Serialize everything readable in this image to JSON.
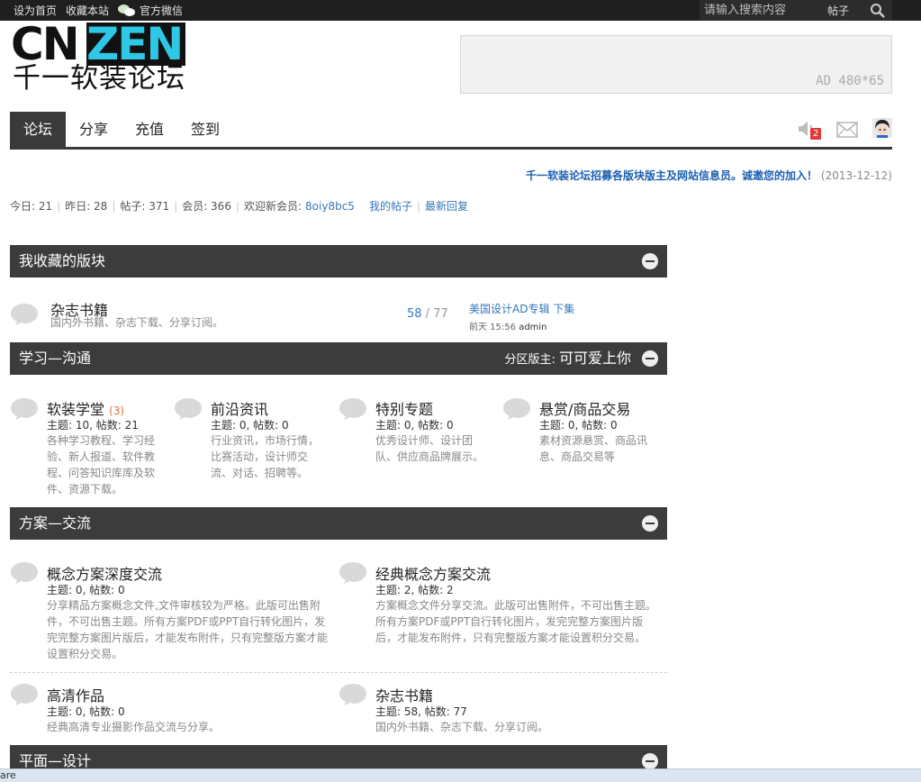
{
  "topbar": {
    "set_home": "设为首页",
    "bookmark": "收藏本站",
    "wechat": "官方微信",
    "search_placeholder": "请输入搜索内容",
    "search_type": "帖子"
  },
  "logo": {
    "text_a": "CN",
    "text_b": "ZEN",
    "subtitle": "千一软装论坛"
  },
  "ad": {
    "label": "AD 480*65"
  },
  "nav": {
    "tabs": [
      {
        "label": "论坛"
      },
      {
        "label": "分享"
      },
      {
        "label": "充值"
      },
      {
        "label": "签到"
      }
    ],
    "notification_count": "2"
  },
  "notice": {
    "text": "千一软装论坛招募各版块版主及网站信息员。诚邀您的加入！",
    "date": "(2013-12-12)"
  },
  "stats": {
    "today": "今日: 21",
    "yesterday": "昨日: 28",
    "posts": "帖子: 371",
    "members": "会员: 366",
    "welcome": "欢迎新会员:",
    "new_member": "8oiy8bc5",
    "my_posts": "我的帖子",
    "latest_reply": "最新回复"
  },
  "sections": {
    "favorites": {
      "title": "我收藏的版块",
      "item": {
        "name": "杂志书籍",
        "desc": "国内外书籍、杂志下载、分享订阅。",
        "count_a": "58",
        "count_sep": " / ",
        "count_b": "77",
        "last_title": "美国设计AD专辑 下集",
        "last_time": "前天 15:56",
        "last_user": "admin"
      }
    },
    "study": {
      "title": "学习—沟通",
      "moderator_label": "分区版主:",
      "moderator": "可可爱上你",
      "forums": [
        {
          "name": "软装学堂",
          "new": "(3)",
          "meta": "主题: 10, 帖数: 21",
          "desc": "各种学习教程、学习经验、新人报道、软件教程、问答知识库库及软件、资源下载。"
        },
        {
          "name": "前沿资讯",
          "new": "",
          "meta": "主题: 0, 帖数: 0",
          "desc": "行业资讯，市场行情，比赛活动，设计师交流、对话、招聘等。"
        },
        {
          "name": "特别专题",
          "new": "",
          "meta": "主题: 0, 帖数: 0",
          "desc": "优秀设计师、设计团队、供应商品牌展示。"
        },
        {
          "name": "悬赏/商品交易",
          "new": "",
          "meta": "主题: 0, 帖数: 0",
          "desc": "素材资源悬赏、商品讯息、商品交易等"
        }
      ]
    },
    "scheme": {
      "title": "方案—交流",
      "forums": [
        {
          "name": "概念方案深度交流",
          "meta": "主题: 0, 帖数: 0",
          "desc": "分享精品方案概念文件,文件审核较为严格。此版可出售附件，不可出售主题。所有方案PDF或PPT自行转化图片，发完完整方案图片版后，才能发布附件，只有完整版方案才能设置积分交易。"
        },
        {
          "name": "经典概念方案交流",
          "meta": "主题: 2, 帖数: 2",
          "desc": "方案概念文件分享交流。此版可出售附件，不可出售主题。所有方案PDF或PPT自行转化图片，发完完整方案图片版后，才能发布附件，只有完整版方案才能设置积分交易。"
        },
        {
          "name": "高清作品",
          "meta": "主题: 0, 帖数: 0",
          "desc": "经典高清专业摄影作品交流与分享。"
        },
        {
          "name": "杂志书籍",
          "meta": "主题: 58, 帖数: 77",
          "desc": "国内外书籍、杂志下载、分享订阅。"
        }
      ]
    },
    "graphic": {
      "title": "平面—设计"
    }
  },
  "statusbar": {
    "text": "are"
  },
  "icons": {
    "search": "search-icon",
    "wechat": "wechat-icon",
    "sound": "speaker-icon",
    "mail": "mail-icon",
    "avatar": "avatar",
    "bubble": "forum-bubble-icon",
    "collapse": "collapse-icon"
  }
}
